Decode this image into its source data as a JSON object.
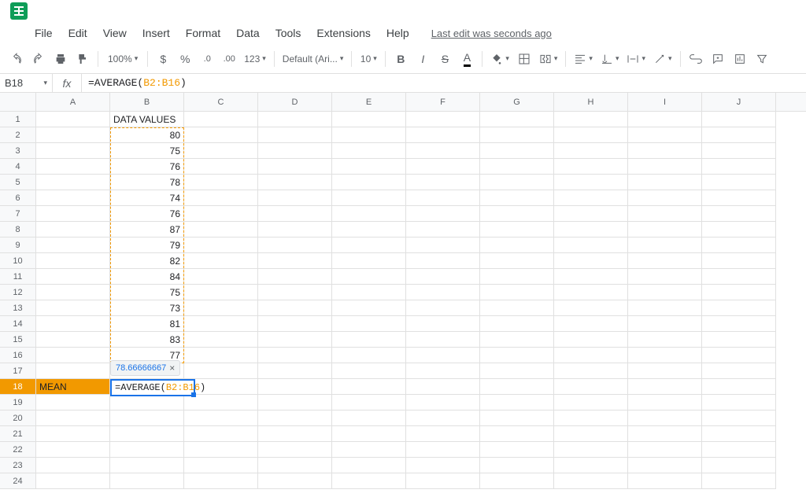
{
  "menubar": {
    "items": [
      "File",
      "Edit",
      "View",
      "Insert",
      "Format",
      "Data",
      "Tools",
      "Extensions",
      "Help"
    ],
    "last_edit": "Last edit was seconds ago"
  },
  "toolbar": {
    "zoom": "100%",
    "currency": "$",
    "percent": "%",
    "dec_less": ".0",
    "dec_more": ".00",
    "num_fmt": "123",
    "font": "Default (Ari...",
    "size": "10",
    "bold": "B",
    "italic": "I",
    "strike": "S",
    "text_color": "A"
  },
  "formula_bar": {
    "name_box": "B18",
    "fx": "fx",
    "prefix": "=AVERAGE(",
    "range": "B2:B16",
    "suffix": ")"
  },
  "columns": [
    "A",
    "B",
    "C",
    "D",
    "E",
    "F",
    "G",
    "H",
    "I",
    "J"
  ],
  "rows": {
    "count": 24,
    "header_label": "DATA VALUES",
    "values": [
      "80",
      "75",
      "76",
      "78",
      "74",
      "76",
      "87",
      "79",
      "82",
      "84",
      "75",
      "73",
      "81",
      "83",
      "77"
    ],
    "mean_label": "MEAN"
  },
  "tooltip": {
    "value": "78.66666667",
    "close": "×"
  },
  "active_formula": {
    "prefix": "=AVERAGE(",
    "range": "B2:B16",
    "suffix": ")"
  },
  "chart_data": {
    "type": "table",
    "title": "DATA VALUES",
    "values": [
      80,
      75,
      76,
      78,
      74,
      76,
      87,
      79,
      82,
      84,
      75,
      73,
      81,
      83,
      77
    ],
    "mean": 78.66666667
  }
}
